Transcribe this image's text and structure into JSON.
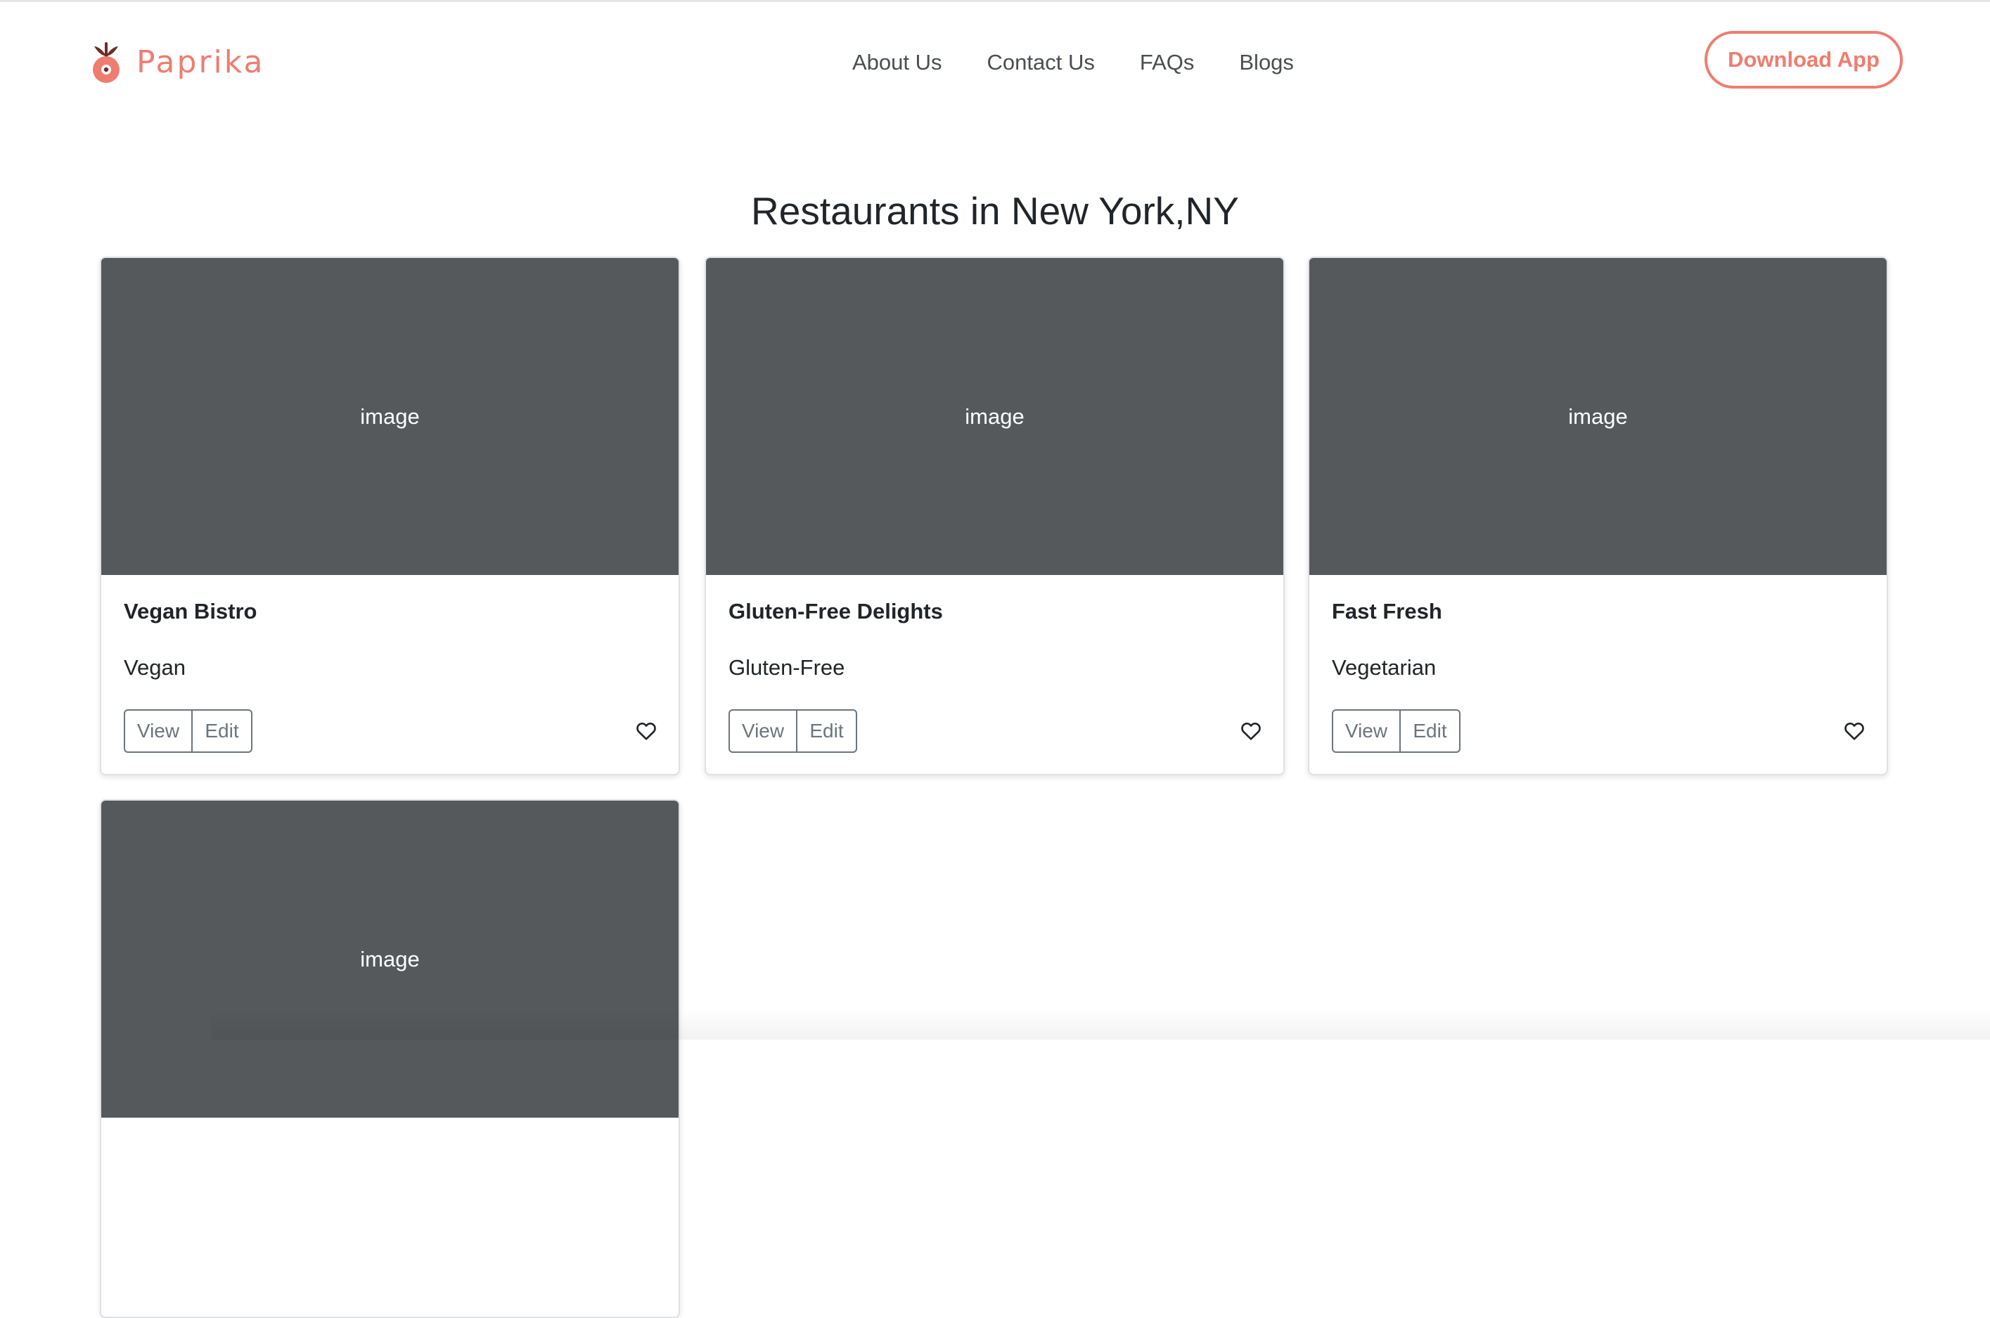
{
  "brand": {
    "name": "Paprika",
    "logo_icon": "paprika-logo-icon",
    "accent_color": "#ee7d70"
  },
  "nav": {
    "links": [
      {
        "label": "About Us"
      },
      {
        "label": "Contact Us"
      },
      {
        "label": "FAQs"
      },
      {
        "label": "Blogs"
      }
    ],
    "download_label": "Download App"
  },
  "main": {
    "title": "Restaurants in New York,NY",
    "cards": [
      {
        "image_label": "image",
        "name": "Vegan Bistro",
        "category": "Vegan",
        "view_label": "View",
        "edit_label": "Edit",
        "favorite_icon": "heart-icon"
      },
      {
        "image_label": "image",
        "name": "Gluten-Free Delights",
        "category": "Gluten-Free",
        "view_label": "View",
        "edit_label": "Edit",
        "favorite_icon": "heart-icon"
      },
      {
        "image_label": "image",
        "name": "Fast Fresh",
        "category": "Vegetarian",
        "view_label": "View",
        "edit_label": "Edit",
        "favorite_icon": "heart-icon"
      },
      {
        "image_label": "image"
      }
    ],
    "image_placeholder_color": "#55595c"
  }
}
